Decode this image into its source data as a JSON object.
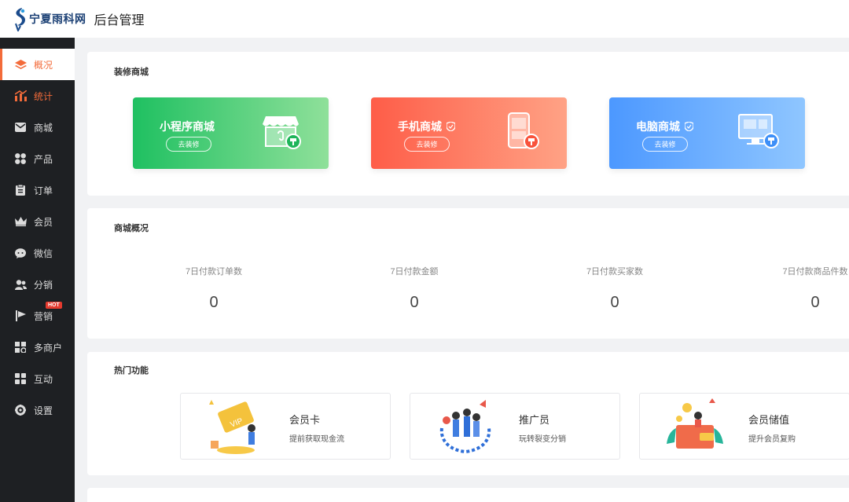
{
  "header": {
    "logo_text": "宁夏雨科网",
    "title": "后台管理"
  },
  "sidebar": {
    "items": [
      {
        "label": "概况",
        "icon": "layers-icon"
      },
      {
        "label": "统计",
        "icon": "chart-icon"
      },
      {
        "label": "商城",
        "icon": "mail-icon"
      },
      {
        "label": "产品",
        "icon": "apps-icon"
      },
      {
        "label": "订单",
        "icon": "clipboard-icon"
      },
      {
        "label": "会员",
        "icon": "crown-icon"
      },
      {
        "label": "微信",
        "icon": "chat-icon"
      },
      {
        "label": "分销",
        "icon": "users-icon"
      },
      {
        "label": "营销",
        "icon": "flag-icon",
        "badge": "HOT"
      },
      {
        "label": "多商户",
        "icon": "store-icon"
      },
      {
        "label": "互动",
        "icon": "grid-icon"
      },
      {
        "label": "设置",
        "icon": "gear-icon"
      }
    ]
  },
  "decorate": {
    "title": "装修商城",
    "tiles": [
      {
        "name": "小程序商城",
        "button": "去装修",
        "color_from": "#1fc061",
        "color_to": "#8fe09a"
      },
      {
        "name": "手机商城",
        "button": "去装修",
        "color_from": "#fe5d48",
        "color_to": "#ffa285"
      },
      {
        "name": "电脑商城",
        "button": "去装修",
        "color_from": "#4c98ff",
        "color_to": "#8fc6ff"
      }
    ]
  },
  "overview": {
    "title": "商城概况",
    "stats": [
      {
        "label": "7日付款订单数",
        "value": "0"
      },
      {
        "label": "7日付款金额",
        "value": "0"
      },
      {
        "label": "7日付款买家数",
        "value": "0"
      },
      {
        "label": "7日付款商品件数",
        "value": "0"
      }
    ]
  },
  "hot": {
    "title": "热门功能",
    "features": [
      {
        "title": "会员卡",
        "sub": "提前获取现金流",
        "icon": "vip-card-illustration"
      },
      {
        "title": "推广员",
        "sub": "玩转裂变分销",
        "icon": "promoter-illustration"
      },
      {
        "title": "会员储值",
        "sub": "提升会员复购",
        "icon": "wallet-illustration"
      }
    ]
  },
  "colors": {
    "accent": "#f36b3a",
    "sidebar_bg": "#1e2023",
    "page_bg": "#f1f2f4"
  }
}
